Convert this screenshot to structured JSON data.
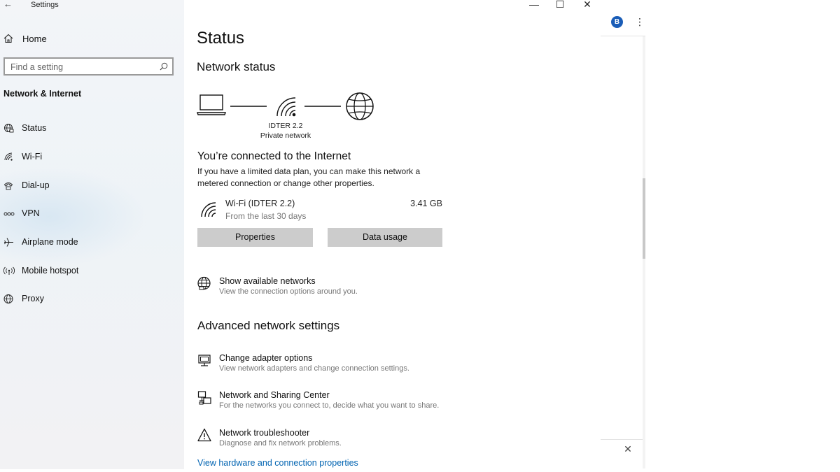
{
  "window": {
    "app_title": "Settings",
    "back_glyph": "←",
    "controls": {
      "minimize": "—",
      "maximize": "☐",
      "close": "✕"
    }
  },
  "sidebar": {
    "home_label": "Home",
    "search_placeholder": "Find a setting",
    "section_title": "Network & Internet",
    "items": [
      {
        "label": "Status",
        "icon": "status-globe-icon"
      },
      {
        "label": "Wi-Fi",
        "icon": "wifi-icon"
      },
      {
        "label": "Dial-up",
        "icon": "dialup-icon"
      },
      {
        "label": "VPN",
        "icon": "vpn-icon"
      },
      {
        "label": "Airplane mode",
        "icon": "airplane-icon"
      },
      {
        "label": "Mobile hotspot",
        "icon": "hotspot-icon"
      },
      {
        "label": "Proxy",
        "icon": "globe-icon"
      }
    ]
  },
  "main": {
    "page_title": "Status",
    "network_status_heading": "Network status",
    "network_name": "IDTER 2.2",
    "network_type": "Private network",
    "connected_title": "You’re connected to the Internet",
    "connected_desc": "If you have a limited data plan, you can make this network a metered connection or change other properties.",
    "wifi": {
      "name": "Wi-Fi (IDTER 2.2)",
      "period": "From the last 30 days",
      "usage": "3.41 GB"
    },
    "buttons": {
      "properties": "Properties",
      "data_usage": "Data usage"
    },
    "show_networks": {
      "title": "Show available networks",
      "desc": "View the connection options around you."
    },
    "advanced_heading": "Advanced network settings",
    "advanced_items": [
      {
        "title": "Change adapter options",
        "desc": "View network adapters and change connection settings."
      },
      {
        "title": "Network and Sharing Center",
        "desc": "For the networks you connect to, decide what you want to share."
      },
      {
        "title": "Network troubleshooter",
        "desc": "Diagnose and fix network problems."
      }
    ],
    "bottom_link": "View hardware and connection properties"
  },
  "background_browser": {
    "avatar_letter": "B",
    "more_glyph": "⋮",
    "close_glyph": "✕"
  },
  "colors": {
    "accent_link": "#0063b1",
    "button_bg": "#cccccc",
    "avatar_bg": "#1a5db7"
  }
}
